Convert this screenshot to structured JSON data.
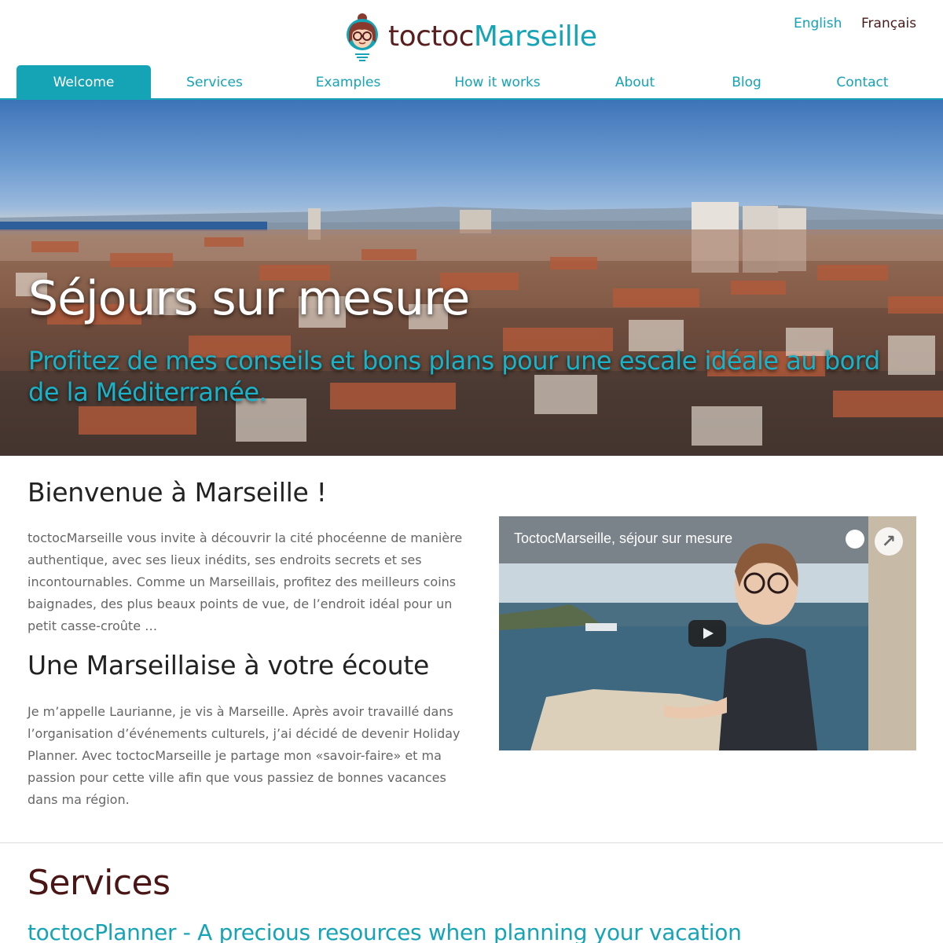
{
  "header": {
    "logo_part1": "toctoc",
    "logo_part2": "Marseille",
    "languages": [
      {
        "label": "English"
      },
      {
        "label": "Français"
      }
    ]
  },
  "nav": {
    "items": [
      {
        "label": "Welcome"
      },
      {
        "label": "Services"
      },
      {
        "label": "Examples"
      },
      {
        "label": "How it works"
      },
      {
        "label": "About"
      },
      {
        "label": "Blog"
      },
      {
        "label": "Contact"
      }
    ]
  },
  "hero": {
    "title": "Séjours sur mesure",
    "subtitle": "Profitez de mes conseils et bons plans pour une escale idéale au bord de la Méditerranée."
  },
  "welcome": {
    "heading": "Bienvenue à Marseille !",
    "intro": "toctocMarseille vous invite à découvrir la cité phocéenne de manière authentique, avec ses lieux inédits, ses endroits secrets et ses incontournables. Comme un Marseillais, profitez des meilleurs coins baignades, des plus beaux points de vue, de l’endroit idéal pour un petit casse-croûte …",
    "heading2": "Une Marseillaise à votre écoute",
    "about": "Je m’appelle Laurianne, je vis à Marseille. Après avoir travaillé dans l’organisation d’événements culturels, j’ai décidé de devenir Holiday Planner. Avec toctocMarseille je partage mon «savoir-faire» et ma passion pour cette ville afin que vous passiez de bonnes vacances dans ma région.",
    "video": {
      "title": "ToctocMarseille, séjour sur mesure"
    }
  },
  "services": {
    "title": "Services",
    "subtitle": "toctocPlanner - A precious resources when planning your vacation"
  },
  "colors": {
    "accent": "#15a3b6",
    "brand_dark": "#5a1e1e"
  }
}
